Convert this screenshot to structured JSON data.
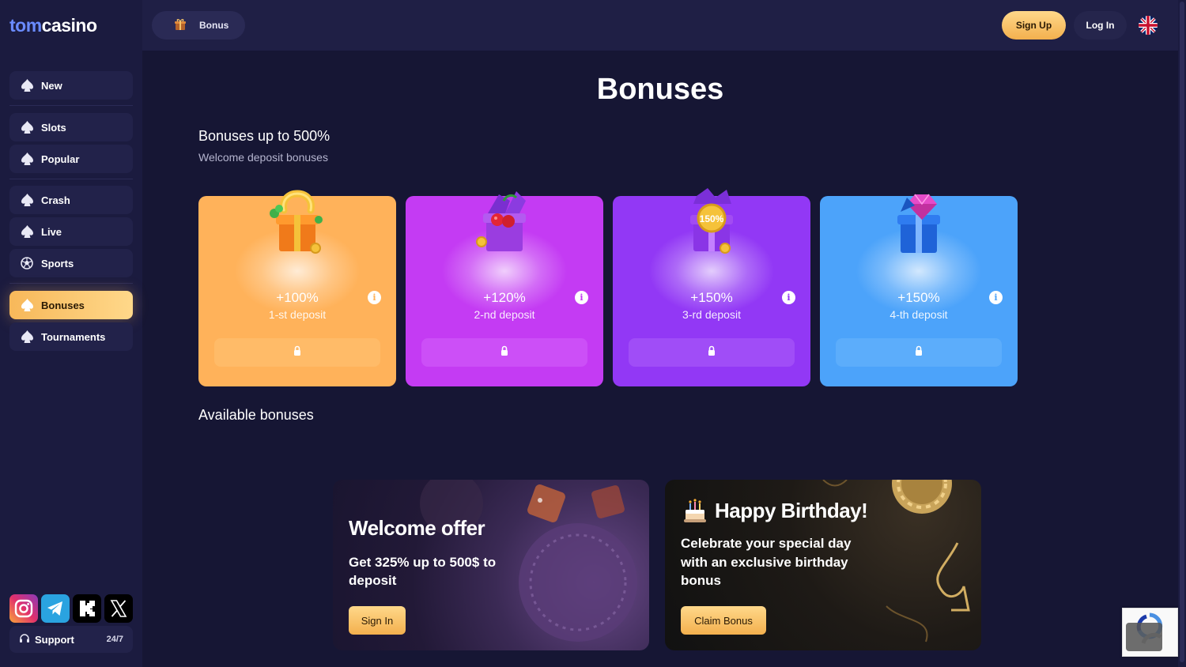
{
  "brand": {
    "tom": "tom",
    "casino": "casino"
  },
  "header": {
    "bonus_pill": "Bonus",
    "signup": "Sign Up",
    "login": "Log In",
    "language_icon": "uk-flag-icon"
  },
  "sidebar": {
    "items": [
      {
        "label": "New",
        "icon": "spade-icon"
      },
      {
        "label": "Slots",
        "icon": "spade-icon"
      },
      {
        "label": "Popular",
        "icon": "spade-icon"
      },
      {
        "label": "Crash",
        "icon": "spade-icon"
      },
      {
        "label": "Live",
        "icon": "spade-icon"
      },
      {
        "label": "Sports",
        "icon": "soccer-ball-icon"
      },
      {
        "label": "Bonuses",
        "icon": "spade-icon",
        "active": true
      },
      {
        "label": "Tournaments",
        "icon": "spade-icon"
      }
    ],
    "socials": [
      "instagram-icon",
      "telegram-icon",
      "kick-icon",
      "x-icon"
    ],
    "support": {
      "label": "Support",
      "hours": "24/7"
    }
  },
  "main": {
    "title": "Bonuses",
    "section_title": "Bonuses up to 500%",
    "section_subtitle": "Welcome deposit bonuses",
    "deposit_cards": [
      {
        "percent": "+100%",
        "label": "1-st deposit",
        "color": "#ffb25a"
      },
      {
        "percent": "+120%",
        "label": "2-nd deposit",
        "color": "#c43bf3"
      },
      {
        "percent": "+150%",
        "label": "3-rd deposit",
        "color": "#9238f5",
        "coin_text": "150%"
      },
      {
        "percent": "+150%",
        "label": "4-th deposit",
        "color": "#4ca3fa"
      }
    ],
    "available_title": "Available bonuses",
    "promos": [
      {
        "title": "Welcome offer",
        "desc_line1": "Get 325% up to 500$ to",
        "desc_line2": "deposit",
        "button": "Sign In"
      },
      {
        "title": "Happy Birthday!",
        "desc_line1": "Celebrate your special day",
        "desc_line2": "with an exclusive birthday",
        "desc_line3": "bonus",
        "button": "Claim Bonus"
      }
    ]
  },
  "colors": {
    "background": "#161634",
    "sidebar": "#1b1b3f",
    "accent_gold": "#f3b04e",
    "brand_blue": "#6a8bff"
  }
}
